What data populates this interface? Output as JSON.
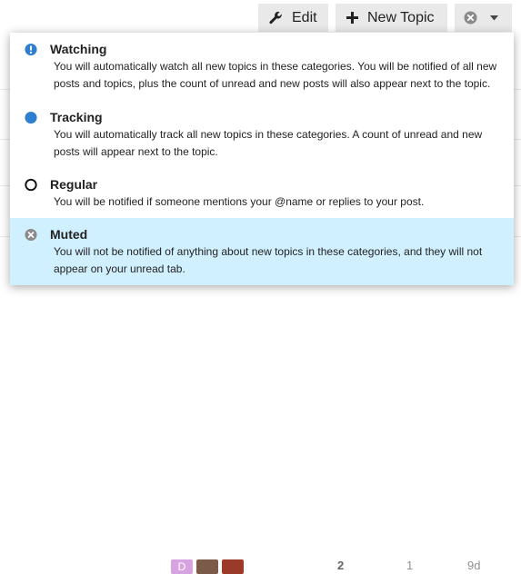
{
  "toolbar": {
    "edit_label": "Edit",
    "new_topic_label": "New Topic",
    "notifications_icon": "muted-x-circle-icon",
    "chevron_icon": "caret-down-icon"
  },
  "notification_levels": [
    {
      "id": "watching",
      "title": "Watching",
      "description": "You will automatically watch all new topics in these categories. You will be notified of all new posts and topics, plus the count of unread and new posts will also appear next to the topic.",
      "icon": "exclamation-circle-icon",
      "icon_color": "#2f7fd1",
      "selected": false
    },
    {
      "id": "tracking",
      "title": "Tracking",
      "description": "You will automatically track all new topics in these categories. A count of unread and new posts will appear next to the topic.",
      "icon": "filled-circle-icon",
      "icon_color": "#2f7fd1",
      "selected": false
    },
    {
      "id": "regular",
      "title": "Regular",
      "description": "You will be notified if someone mentions your @name or replies to your post.",
      "icon": "circle-outline-icon",
      "icon_color": "#111111",
      "selected": false
    },
    {
      "id": "muted",
      "title": "Muted",
      "description": "You will not be notified of anything about new topics in these categories, and they will not appear on your unread tab.",
      "icon": "x-circle-icon",
      "icon_color": "#8a8a8a",
      "selected": true
    }
  ],
  "background_row": {
    "avatar_letter": "D",
    "replies": "2",
    "views": "1",
    "activity": "9d"
  },
  "colors": {
    "button_bg": "#e9e9e9",
    "selected_bg": "#d1f0ff",
    "accent_blue": "#2f7fd1"
  }
}
